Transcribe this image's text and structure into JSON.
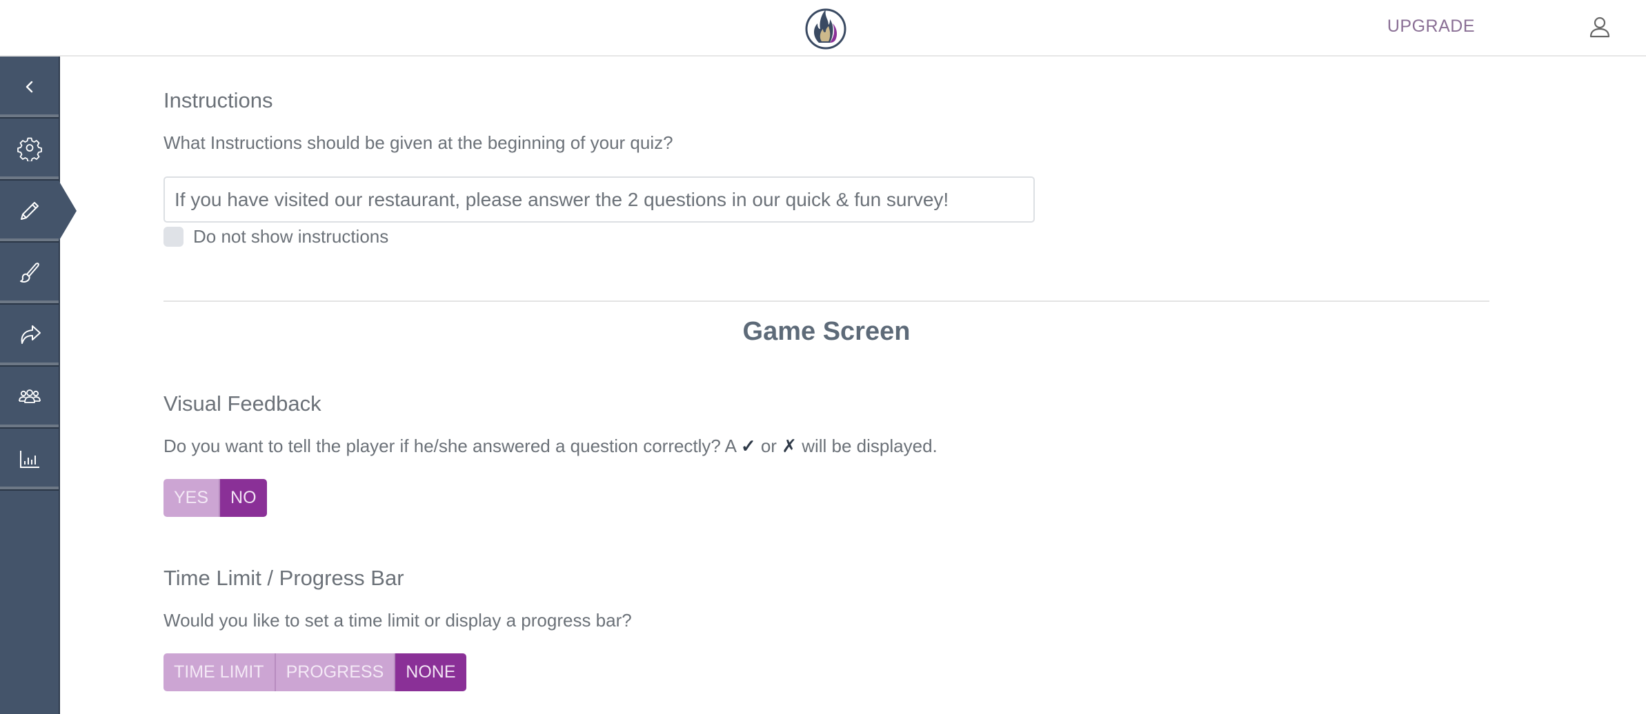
{
  "header": {
    "logo": "flame-logo",
    "upgrade_label": "UPGRADE",
    "user_icon": "user-icon"
  },
  "sidebar": {
    "items": [
      {
        "name": "collapse",
        "icon": "chevron-left-icon",
        "active": false
      },
      {
        "name": "settings",
        "icon": "gear-icon",
        "active": false
      },
      {
        "name": "edit",
        "icon": "pencil-icon",
        "active": true
      },
      {
        "name": "design",
        "icon": "paintbrush-icon",
        "active": false
      },
      {
        "name": "share",
        "icon": "share-arrow-icon",
        "active": false
      },
      {
        "name": "audience",
        "icon": "group-icon",
        "active": false
      },
      {
        "name": "analytics",
        "icon": "bar-chart-icon",
        "active": false
      }
    ]
  },
  "instructions": {
    "title": "Instructions",
    "description": "What Instructions should be given at the beginning of your quiz?",
    "input_value": "If you have visited our restaurant, please answer the 2 questions in our quick & fun survey!",
    "checkbox_label": "Do not show instructions",
    "checkbox_checked": false
  },
  "game_screen": {
    "title": "Game Screen"
  },
  "visual_feedback": {
    "title": "Visual Feedback",
    "description_before": "Do you want to tell the player if he/she answered a question correctly? A ",
    "check_glyph": "✓",
    "description_middle": " or ",
    "x_glyph": "✗",
    "description_after": " will be displayed.",
    "options": [
      "YES",
      "NO"
    ],
    "selected": "NO"
  },
  "time_limit": {
    "title": "Time Limit / Progress Bar",
    "description": "Would you like to set a time limit or display a progress bar?",
    "options": [
      "TIME LIMIT",
      "PROGRESS",
      "NONE"
    ],
    "selected": "NONE"
  },
  "colors": {
    "sidebar_bg": "#44546a",
    "accent_selected": "#8a3097",
    "accent_unselected": "#cca5d3",
    "upgrade_text": "#8a6f95"
  }
}
